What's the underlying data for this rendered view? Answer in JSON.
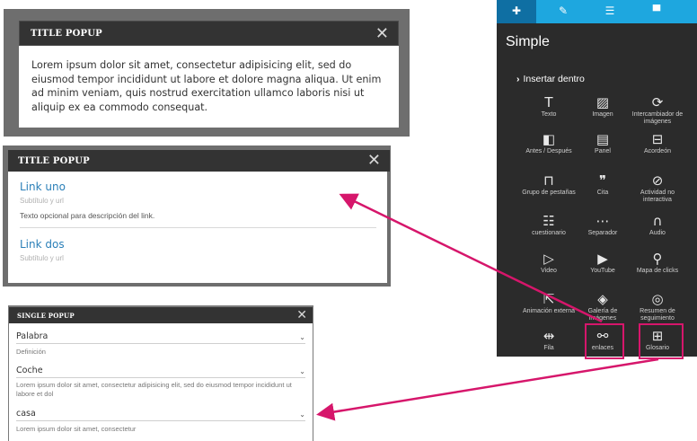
{
  "popup1": {
    "title": "TITLE POPUP",
    "close_icon": "close-icon",
    "text": "Lorem ipsum dolor sit amet, consectetur adipisicing elit, sed do eiusmod tempor incididunt ut labore et dolore magna aliqua. Ut enim ad minim veniam, quis nostrud exercitation ullamco laboris nisi ut aliquip ex ea commodo consequat."
  },
  "popup2": {
    "title": "TITLE POPUP",
    "close_icon": "close-icon",
    "links": [
      {
        "title": "Link uno",
        "subtitle": "Subtítulo y url",
        "description": "Texto opcional para descripción del link."
      },
      {
        "title": "Link dos",
        "subtitle": "Subtítulo y url"
      }
    ]
  },
  "popup3": {
    "title": "SINGLE POPUP",
    "close_icon": "close-icon",
    "items": [
      {
        "term": "Palabra",
        "definition": "Definición"
      },
      {
        "term": "Coche",
        "definition": "Lorem ipsum dolor sit amet, consectetur adipisicing elit, sed do eiusmod tempor incididunt ut labore et dol"
      },
      {
        "term": "casa",
        "definition": "Lorem ipsum dolor sit amet, consectetur"
      }
    ]
  },
  "panel": {
    "tabs": [
      {
        "icon": "plus-icon",
        "glyph": "✚"
      },
      {
        "icon": "pencil-icon",
        "glyph": "✎"
      },
      {
        "icon": "list-icon",
        "glyph": "☰"
      },
      {
        "icon": "comment-icon",
        "glyph": "▀"
      }
    ],
    "title": "Simple",
    "insert_label": "Insertar dentro",
    "tools": [
      {
        "label": "Texto",
        "icon": "text-icon",
        "glyph": "T"
      },
      {
        "label": "Imagen",
        "icon": "image-icon",
        "glyph": "▨"
      },
      {
        "label": "Intercambiador de imágenes",
        "icon": "swap-icon",
        "glyph": "⟳"
      },
      {
        "label": "Antes / Después",
        "icon": "before-after-icon",
        "glyph": "◧"
      },
      {
        "label": "Panel",
        "icon": "panel-icon",
        "glyph": "▤"
      },
      {
        "label": "Acordeón",
        "icon": "accordion-icon",
        "glyph": "⊟"
      },
      {
        "label": "Grupo de pestañas",
        "icon": "tabs-icon",
        "glyph": "⊓"
      },
      {
        "label": "Cita",
        "icon": "quote-icon",
        "glyph": "❞"
      },
      {
        "label": "Actividad no interactiva",
        "icon": "no-activity-icon",
        "glyph": "⊘"
      },
      {
        "label": "cuestionario",
        "icon": "quiz-icon",
        "glyph": "☷"
      },
      {
        "label": "Separador",
        "icon": "separator-icon",
        "glyph": "⋯"
      },
      {
        "label": "Audio",
        "icon": "headphones-icon",
        "glyph": "∩"
      },
      {
        "label": "Video",
        "icon": "video-icon",
        "glyph": "▷"
      },
      {
        "label": "YouTube",
        "icon": "youtube-icon",
        "glyph": "▶"
      },
      {
        "label": "Mapa de clicks",
        "icon": "map-pin-icon",
        "glyph": "⚲"
      },
      {
        "label": "Animación externa",
        "icon": "external-animation-icon",
        "glyph": "⇱"
      },
      {
        "label": "Galería de imágenes",
        "icon": "gallery-icon",
        "glyph": "◈"
      },
      {
        "label": "Resumen de seguimiento",
        "icon": "tracking-icon",
        "glyph": "◎"
      },
      {
        "label": "Fila",
        "icon": "row-icon",
        "glyph": "⇹"
      },
      {
        "label": "enlaces",
        "icon": "link-icon",
        "glyph": "⚯"
      },
      {
        "label": "Glosario",
        "icon": "book-icon",
        "glyph": "⊞"
      }
    ],
    "accent": "#1ea7df",
    "highlight_color": "#d6166b"
  }
}
